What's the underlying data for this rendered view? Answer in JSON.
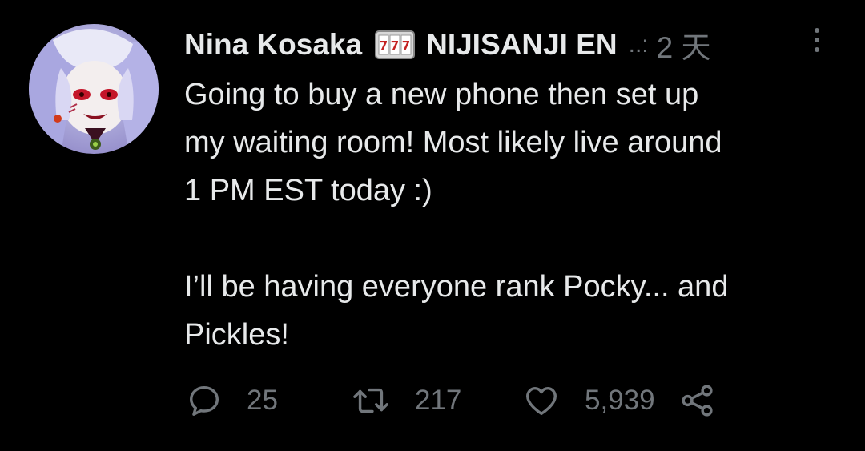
{
  "tweet": {
    "author_name": "Nina Kosaka",
    "author_emoji": "777",
    "author_handle": "NIJISANJI EN",
    "separator": "..:",
    "timestamp": "2 天",
    "text_lines": [
      "Going to buy a new phone then set up",
      "my waiting room! Most likely live around",
      "1 PM EST today :)",
      "I’ll be having everyone rank Pocky... and",
      "Pickles!"
    ]
  },
  "actions": {
    "reply_count": "25",
    "retweet_count": "217",
    "like_count": "5,939"
  },
  "icons": {
    "reply": "reply-bubble-icon",
    "retweet": "retweet-icon",
    "like": "heart-icon",
    "share": "share-icon",
    "more": "more-vertical-icon"
  },
  "colors": {
    "background": "#000000",
    "text": "#e7e9ea",
    "muted": "#71767b"
  }
}
